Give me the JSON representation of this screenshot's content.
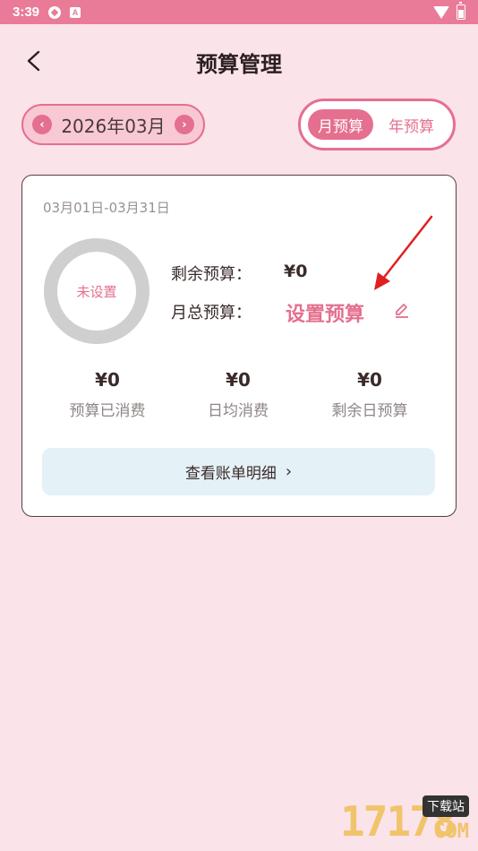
{
  "status_bar": {
    "time": "3:39"
  },
  "header": {
    "title": "预算管理"
  },
  "month_picker": {
    "prev": "‹",
    "next": "›",
    "label": "2026年03月"
  },
  "period_toggle": {
    "monthly": "月预算",
    "yearly": "年预算",
    "selected": "monthly"
  },
  "card": {
    "date_range": "03月01日-03月31日",
    "ring_text": "未设置",
    "remaining_label": "剩余预算：",
    "remaining_value": "¥0",
    "total_label": "月总预算：",
    "set_budget_link": "设置预算",
    "stats": [
      {
        "value": "¥0",
        "label": "预算已消费"
      },
      {
        "value": "¥0",
        "label": "日均消费"
      },
      {
        "value": "¥0",
        "label": "剩余日预算"
      }
    ],
    "detail_button": "查看账单明细"
  },
  "watermark": {
    "digits": "17178",
    "tag": "下载站",
    "suffix": "COM"
  },
  "colors": {
    "accent": "#e56f8e",
    "background": "#fbe3ea",
    "status_bar": "#e97b98",
    "annotation_arrow": "#e02020"
  }
}
